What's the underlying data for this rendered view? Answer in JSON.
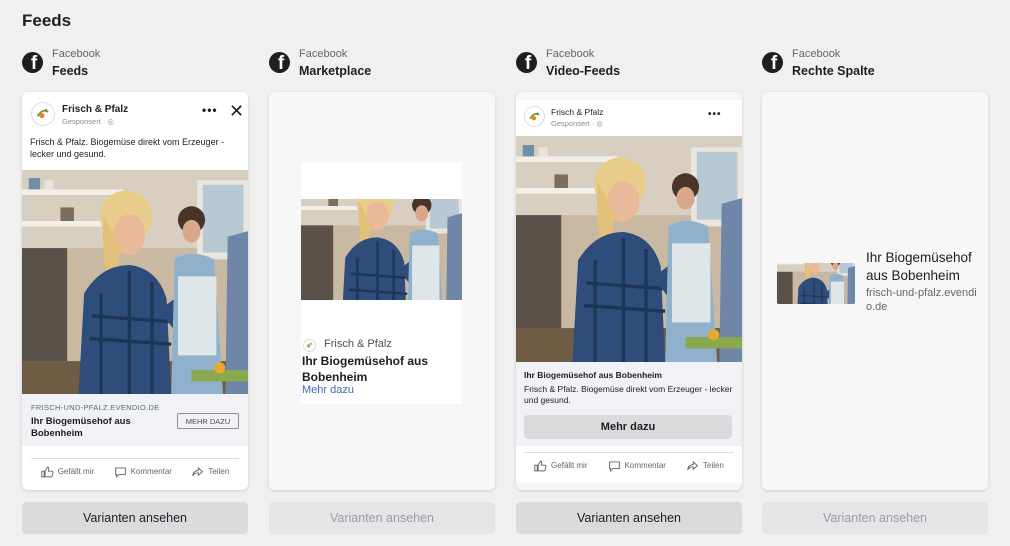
{
  "page": {
    "title": "Feeds"
  },
  "ad": {
    "page_name": "Frisch & Pfalz",
    "sponsored": "Gesponsert · ",
    "primary_text": "Frisch & Pfalz. Biogemüse direkt vom Erzeuger - lecker und gesund.",
    "domain": "FRISCH-UND-PFALZ.EVENDIO.DE",
    "domain_lower": "frisch-und-pfalz.evendio.de",
    "headline": "Ihr Biogemüsehof aus Bobenheim",
    "cta_feed": "MEHR DAZU",
    "cta_video": "Mehr dazu",
    "cta_link": "Mehr dazu",
    "more_icon": "more-horizontal-icon",
    "close_icon": "close-icon"
  },
  "actions": {
    "like": "Gefällt mir",
    "comment": "Kommentar",
    "share": "Teilen"
  },
  "columns": [
    {
      "platform": "Facebook",
      "placement": "Feeds",
      "variants_label": "Varianten ansehen",
      "variants_enabled": true
    },
    {
      "platform": "Facebook",
      "placement": "Marketplace",
      "variants_label": "Varianten ansehen",
      "variants_enabled": false
    },
    {
      "platform": "Facebook",
      "placement": "Video-Feeds",
      "variants_label": "Varianten ansehen",
      "variants_enabled": true
    },
    {
      "platform": "Facebook",
      "placement": "Rechte Spalte",
      "variants_label": "Varianten ansehen",
      "variants_enabled": false
    }
  ],
  "colors": {
    "link_blue": "#4267b2",
    "facebook_logo": "#1c1e21",
    "background": "#f0f0f1"
  }
}
